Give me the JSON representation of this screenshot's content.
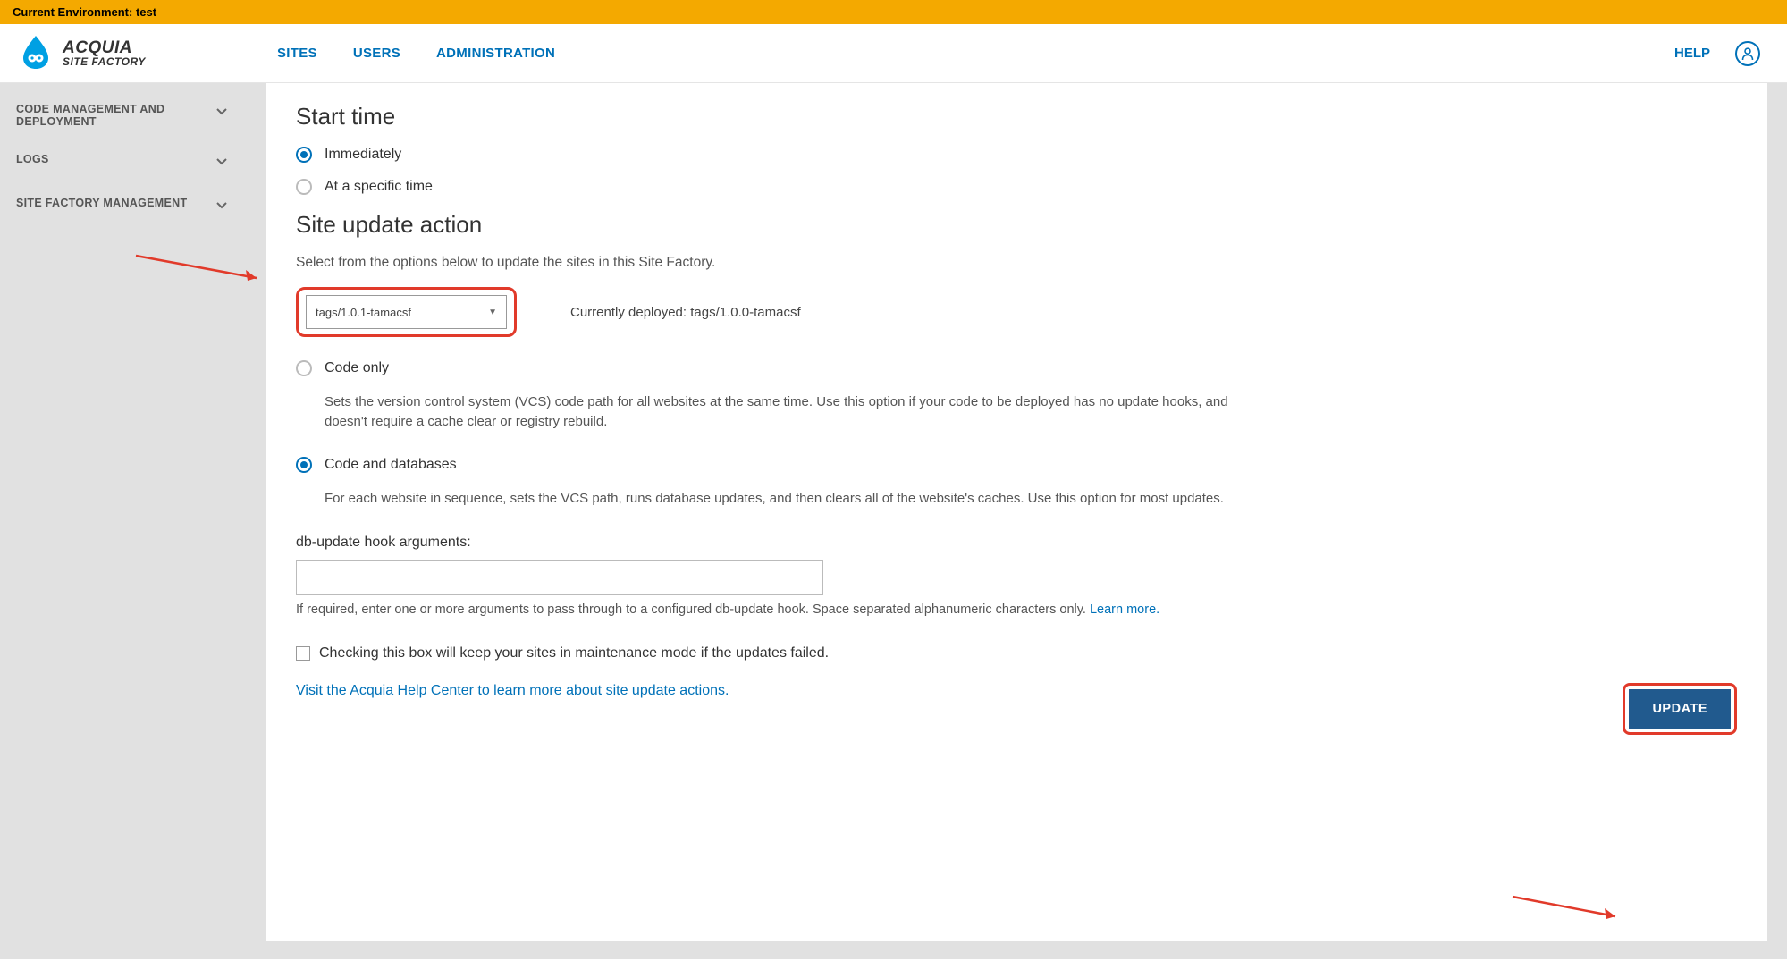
{
  "env_bar": "Current Environment: test",
  "brand": {
    "top": "ACQUIA",
    "bottom": "SITE FACTORY"
  },
  "nav": {
    "sites": "SITES",
    "users": "USERS",
    "admin": "ADMINISTRATION",
    "help": "HELP"
  },
  "sidebar": {
    "items": [
      {
        "label": "CODE MANAGEMENT AND DEPLOYMENT"
      },
      {
        "label": "LOGS"
      },
      {
        "label": "SITE FACTORY MANAGEMENT"
      }
    ]
  },
  "start_time": {
    "heading": "Start time",
    "immediately": "Immediately",
    "specific": "At a specific time"
  },
  "site_update": {
    "heading": "Site update action",
    "intro": "Select from the options below to update the sites in this Site Factory.",
    "select_value": "tags/1.0.1-tamacsf",
    "deployed": "Currently deployed: tags/1.0.0-tamacsf",
    "code_only": {
      "label": "Code only",
      "desc": "Sets the version control system (VCS) code path for all websites at the same time. Use this option if your code to be deployed has no update hooks, and doesn't require a cache clear or registry rebuild."
    },
    "code_db": {
      "label": "Code and databases",
      "desc": "For each website in sequence, sets the VCS path, runs database updates, and then clears all of the website's caches. Use this option for most updates."
    },
    "db_hook_label": "db-update hook arguments:",
    "db_hook_help_a": "If required, enter one or more arguments to pass through to a configured db-update hook. Space separated alphanumeric characters only. ",
    "db_hook_help_link": "Learn more.",
    "maintenance_chk": "Checking this box will keep your sites in maintenance mode if the updates failed.",
    "help_center_link": "Visit the Acquia Help Center to learn more about site update actions.",
    "update_btn": "UPDATE"
  }
}
